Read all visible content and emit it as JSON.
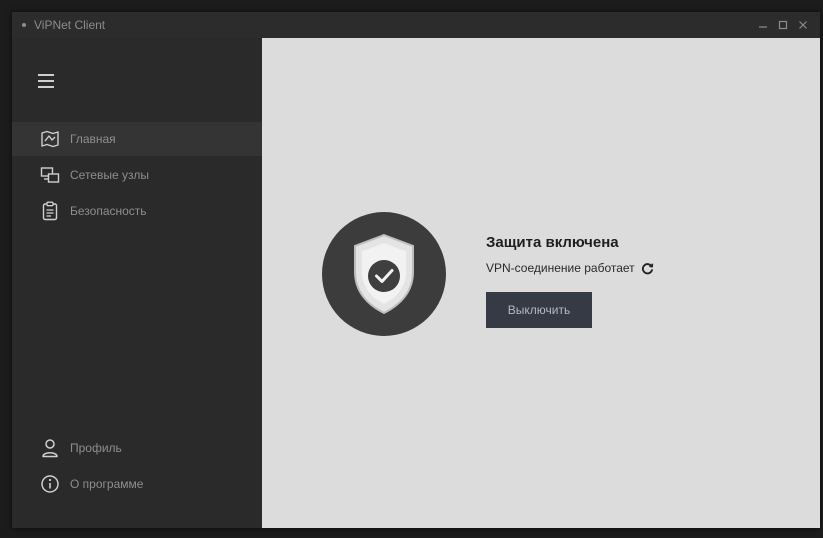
{
  "window": {
    "title": "ViPNet Client",
    "controls": [
      "minimize-icon",
      "maximize-icon",
      "close-icon"
    ]
  },
  "sidebar": {
    "menu_icon": "hamburger-menu-icon",
    "items": [
      {
        "label": "Главная",
        "icon": "home-map-icon",
        "active": true
      },
      {
        "label": "Сетевые узлы",
        "icon": "network-nodes-icon",
        "active": false
      },
      {
        "label": "Безопасность",
        "icon": "clipboard-icon",
        "active": false
      }
    ],
    "bottom_items": [
      {
        "label": "Профиль",
        "icon": "user-icon"
      },
      {
        "label": "О программе",
        "icon": "info-icon"
      }
    ]
  },
  "main": {
    "status_title": "Защита включена",
    "status_subtitle": "VPN-соединение работает",
    "toggle_button_label": "Выключить",
    "status_icon": "shield-check-icon",
    "refresh_icon": "refresh-icon"
  },
  "colors": {
    "sidebar_bg": "#2a2a2a",
    "content_bg": "#dcdcdc",
    "button_bg": "#353a44",
    "shield_circle": "#3c3c3c"
  }
}
